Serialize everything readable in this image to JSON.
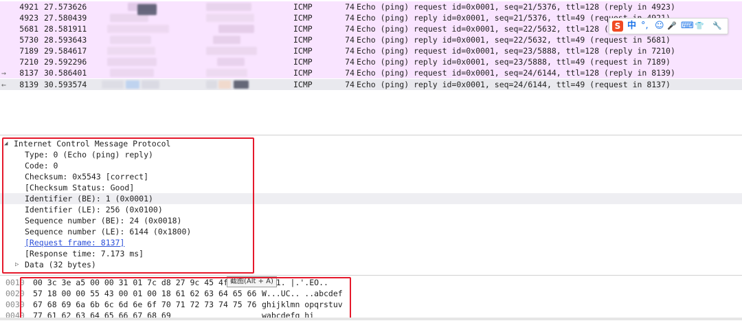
{
  "packets": [
    {
      "mark": "",
      "no": "4921",
      "time": "27.573626",
      "src": "",
      "dst": "",
      "proto": "ICMP",
      "len": "74",
      "info": "Echo (ping) request  id=0x0001, seq=21/5376, ttl=128 (reply in 4923)"
    },
    {
      "mark": "",
      "no": "4923",
      "time": "27.580439",
      "src": "",
      "dst": "",
      "proto": "ICMP",
      "len": "74",
      "info": "Echo (ping) reply    id=0x0001, seq=21/5376, ttl=49 (request in 4921)"
    },
    {
      "mark": "",
      "no": "5681",
      "time": "28.581911",
      "src": "",
      "dst": "",
      "proto": "ICMP",
      "len": "74",
      "info": "Echo (ping) request  id=0x0001, seq=22/5632, ttl=128 (reply in 5730)"
    },
    {
      "mark": "",
      "no": "5730",
      "time": "28.593643",
      "src": "",
      "dst": "",
      "proto": "ICMP",
      "len": "74",
      "info": "Echo (ping) reply    id=0x0001, seq=22/5632, ttl=49 (request in 5681)"
    },
    {
      "mark": "",
      "no": "7189",
      "time": "29.584617",
      "src": "",
      "dst": "",
      "proto": "ICMP",
      "len": "74",
      "info": "Echo (ping) request  id=0x0001, seq=23/5888, ttl=128 (reply in 7210)"
    },
    {
      "mark": "",
      "no": "7210",
      "time": "29.592296",
      "src": "",
      "dst": "",
      "proto": "ICMP",
      "len": "74",
      "info": "Echo (ping) reply    id=0x0001, seq=23/5888, ttl=49 (request in 7189)"
    },
    {
      "mark": "→",
      "no": "8137",
      "time": "30.586401",
      "src": "",
      "dst": "",
      "proto": "ICMP",
      "len": "74",
      "info": "Echo (ping) request  id=0x0001, seq=24/6144, ttl=128 (reply in 8139)"
    },
    {
      "mark": "←",
      "no": "8139",
      "time": "30.593574",
      "src": "",
      "dst": "",
      "proto": "ICMP",
      "len": "74",
      "info": "Echo (ping) reply    id=0x0001, seq=24/6144, ttl=49 (request in 8137)"
    }
  ],
  "ime": {
    "logo": "S",
    "mode": "中",
    "punct": "°,",
    "emoji": "☺",
    "mic": "🎤",
    "keyboard": "⌨",
    "skin": "👕",
    "tools": "🔧"
  },
  "details": {
    "header": "Internet Control Message Protocol",
    "fields": [
      "Type: 0 (Echo (ping) reply)",
      "Code: 0",
      "Checksum: 0x5543 [correct]",
      "[Checksum Status: Good]",
      "Identifier (BE): 1 (0x0001)",
      "Identifier (LE): 256 (0x0100)",
      "Sequence number (BE): 24 (0x0018)",
      "Sequence number (LE): 6144 (0x1800)"
    ],
    "request_frame": "[Request frame: 8137]",
    "response_time": "[Response time: 7.173 ms]",
    "data": "Data (32 bytes)"
  },
  "hex": [
    {
      "off": "0010",
      "bytes": "00 3c 3e a5 00 00 31 01  7c d8 27 9c 45 4f",
      "ascii": "...1. |.'.EO.."
    },
    {
      "off": "0020",
      "bytes": "57 18 00 00 55 43 00 01  00 18 61 62 63 64 65 66",
      "ascii": "W...UC.. ..abcdef"
    },
    {
      "off": "0030",
      "bytes": "67 68 69 6a 6b 6c 6d 6e  6f 70 71 72 73 74 75 76",
      "ascii": "ghijklmn opqrstuv"
    },
    {
      "off": "0040",
      "bytes": "77 61 62 63 64 65 66 67  68 69",
      "ascii": "wabcdefg hi"
    }
  ],
  "tooltip": "截图(Alt + A)",
  "colors": {
    "icmp_row": "#f9e4ff",
    "highlight_box": "#e5182b",
    "link": "#2b4fd8"
  }
}
